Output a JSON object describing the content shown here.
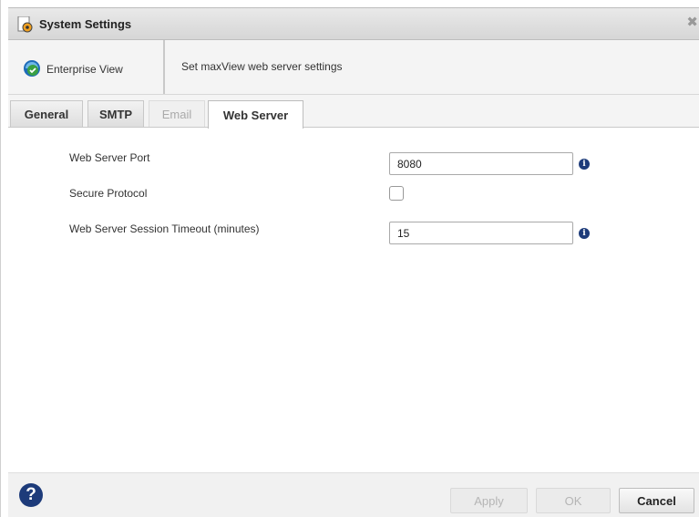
{
  "window": {
    "title": "System Settings",
    "close_glyph": "✖"
  },
  "header": {
    "enterprise_label": "Enterprise View",
    "description": "Set maxView web server settings"
  },
  "tabs": [
    {
      "label": "General",
      "state": "normal"
    },
    {
      "label": "SMTP",
      "state": "normal"
    },
    {
      "label": "Email",
      "state": "disabled"
    },
    {
      "label": "Web Server",
      "state": "active"
    }
  ],
  "form": {
    "port_label": "Web Server Port",
    "port_value": "8080",
    "secure_label": "Secure Protocol",
    "secure_checked": false,
    "timeout_label": "Web Server Session Timeout (minutes)",
    "timeout_value": "15",
    "info_glyph": "i"
  },
  "footer": {
    "help_glyph": "?",
    "apply_label": "Apply",
    "ok_label": "OK",
    "cancel_label": "Cancel"
  },
  "colors": {
    "accent": "#1d3b7a",
    "icon_green": "#3aa043",
    "icon_blue": "#1e6bb8",
    "icon_orange": "#f0a020"
  }
}
